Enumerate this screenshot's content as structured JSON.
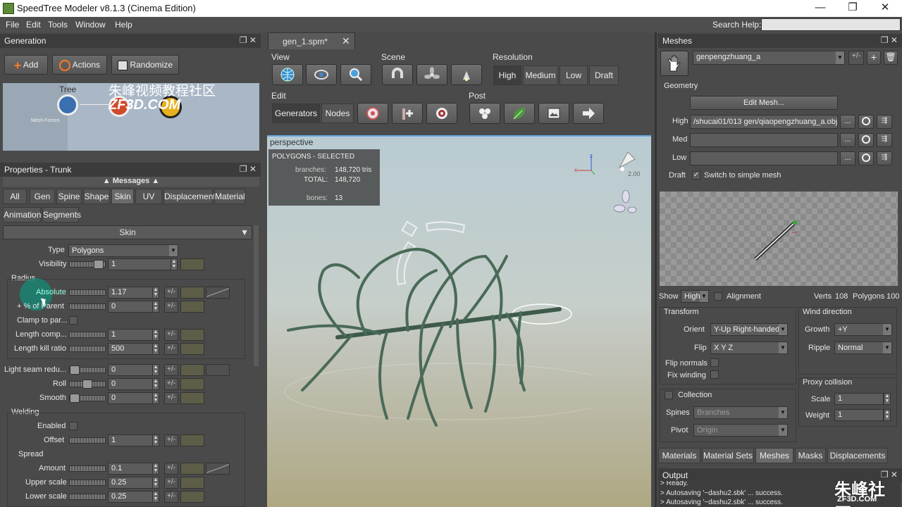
{
  "window": {
    "title": "SpeedTree Modeler v8.1.3 (Cinema Edition)",
    "min": "—",
    "max": "❐",
    "close": "✕"
  },
  "menu": [
    "File",
    "Edit",
    "Tools",
    "Window",
    "Help"
  ],
  "search_help": {
    "label": "Search Help:",
    "value": ""
  },
  "generation": {
    "header": "Generation",
    "add": "Add",
    "actions": "Actions",
    "randomize": "Randomize",
    "graph": {
      "tree_label": "Tree",
      "node_label": "Mesh Forces",
      "watermark1": "朱峰视频教程社区",
      "watermark2": "ZF3D.COM"
    }
  },
  "file_tab": {
    "name": "gen_1.spm*",
    "close": "✕"
  },
  "toolbar": {
    "view": "View",
    "scene": "Scene",
    "resolution": "Resolution",
    "res_options": [
      "High",
      "Medium",
      "Low",
      "Draft"
    ],
    "edit": "Edit",
    "generators": "Generators",
    "nodes": "Nodes",
    "post": "Post"
  },
  "viewport": {
    "label": "perspective",
    "stats_title": "POLYGONS - SELECTED",
    "branches_label": "branches:",
    "branches_value": "148,720 tris",
    "total_label": "TOTAL:",
    "total_value": "148,720",
    "bones_label": "bones:",
    "bones_value": "13",
    "light_value": "2.00"
  },
  "properties": {
    "header": "Properties - Trunk",
    "messages": "Messages",
    "tabs": [
      "All",
      "Gen",
      "Spine",
      "Shape",
      "Skin",
      "UV",
      "Displacement",
      "Material"
    ],
    "tabs2": [
      "Animation",
      "Segments"
    ],
    "section": "Skin",
    "type_label": "Type",
    "type_value": "Polygons",
    "visibility_label": "Visibility",
    "visibility_value": "1",
    "radius_group": "Radius",
    "absolute_label": "Absolute",
    "absolute_value": "1.17",
    "pct_parent_label": "+ % of Parent",
    "pct_parent_value": "0",
    "clamp_label": "Clamp to par...",
    "length_comp_label": "Length comp...",
    "length_comp_value": "1",
    "length_kill_label": "Length kill ratio",
    "length_kill_value": "500",
    "light_seam_label": "Light seam redu...",
    "light_seam_value": "0",
    "roll_label": "Roll",
    "roll_value": "0",
    "smooth_label": "Smooth",
    "smooth_value": "0",
    "welding_group": "Welding",
    "enabled_label": "Enabled",
    "offset_label": "Offset",
    "offset_value": "1",
    "spread_group": "Spread",
    "amount_label": "Amount",
    "amount_value": "0.1",
    "upper_label": "Upper scale",
    "upper_value": "0.25",
    "lower_label": "Lower scale",
    "lower_value": "0.25",
    "pm": "+/-"
  },
  "meshes": {
    "header": "Meshes",
    "mesh_name": "genpengzhuang_a",
    "pm": "+/-",
    "geometry": "Geometry",
    "edit_mesh": "Edit Mesh...",
    "high_label": "High",
    "high_value": "/shucai01/013 gen/qiaopengzhuang_a.obj",
    "med_label": "Med",
    "med_value": "",
    "low_label": "Low",
    "low_value": "",
    "draft_label": "Draft",
    "draft_check": "Switch to simple mesh",
    "dots": "...",
    "show_label": "Show",
    "show_value": "High",
    "alignment_label": "Alignment",
    "verts_label": "Verts",
    "verts_value": "108",
    "polys_label": "Polygons",
    "polys_value": "100",
    "transform": "Transform",
    "orient_label": "Orient",
    "orient_value": "Y-Up Right-handed",
    "flip_label": "Flip",
    "flip_value": "X Y Z",
    "flip_normals": "Flip normals",
    "fix_winding": "Fix winding",
    "wind_dir": "Wind direction",
    "growth_label": "Growth",
    "growth_value": "+Y",
    "ripple_label": "Ripple",
    "ripple_value": "Normal",
    "collection": "Collection",
    "spines_label": "Spines",
    "spines_value": "Branches",
    "pivot_label": "Pivot",
    "pivot_value": "Origin",
    "proxy": "Proxy collision",
    "scale_label": "Scale",
    "scale_value": "1",
    "weight_label": "Weight",
    "weight_value": "1",
    "bottom_tabs": [
      "Materials",
      "Material Sets",
      "Meshes",
      "Masks",
      "Displacements"
    ]
  },
  "output": {
    "header": "Output",
    "lines": [
      "> Ready.",
      "> Autosaving '~dashu2.sbk' ... success.",
      "> Autosaving '~dashu2.sbk' ... success."
    ],
    "watermark": "朱峰社区",
    "watermark2": "ZF3D.COM"
  }
}
